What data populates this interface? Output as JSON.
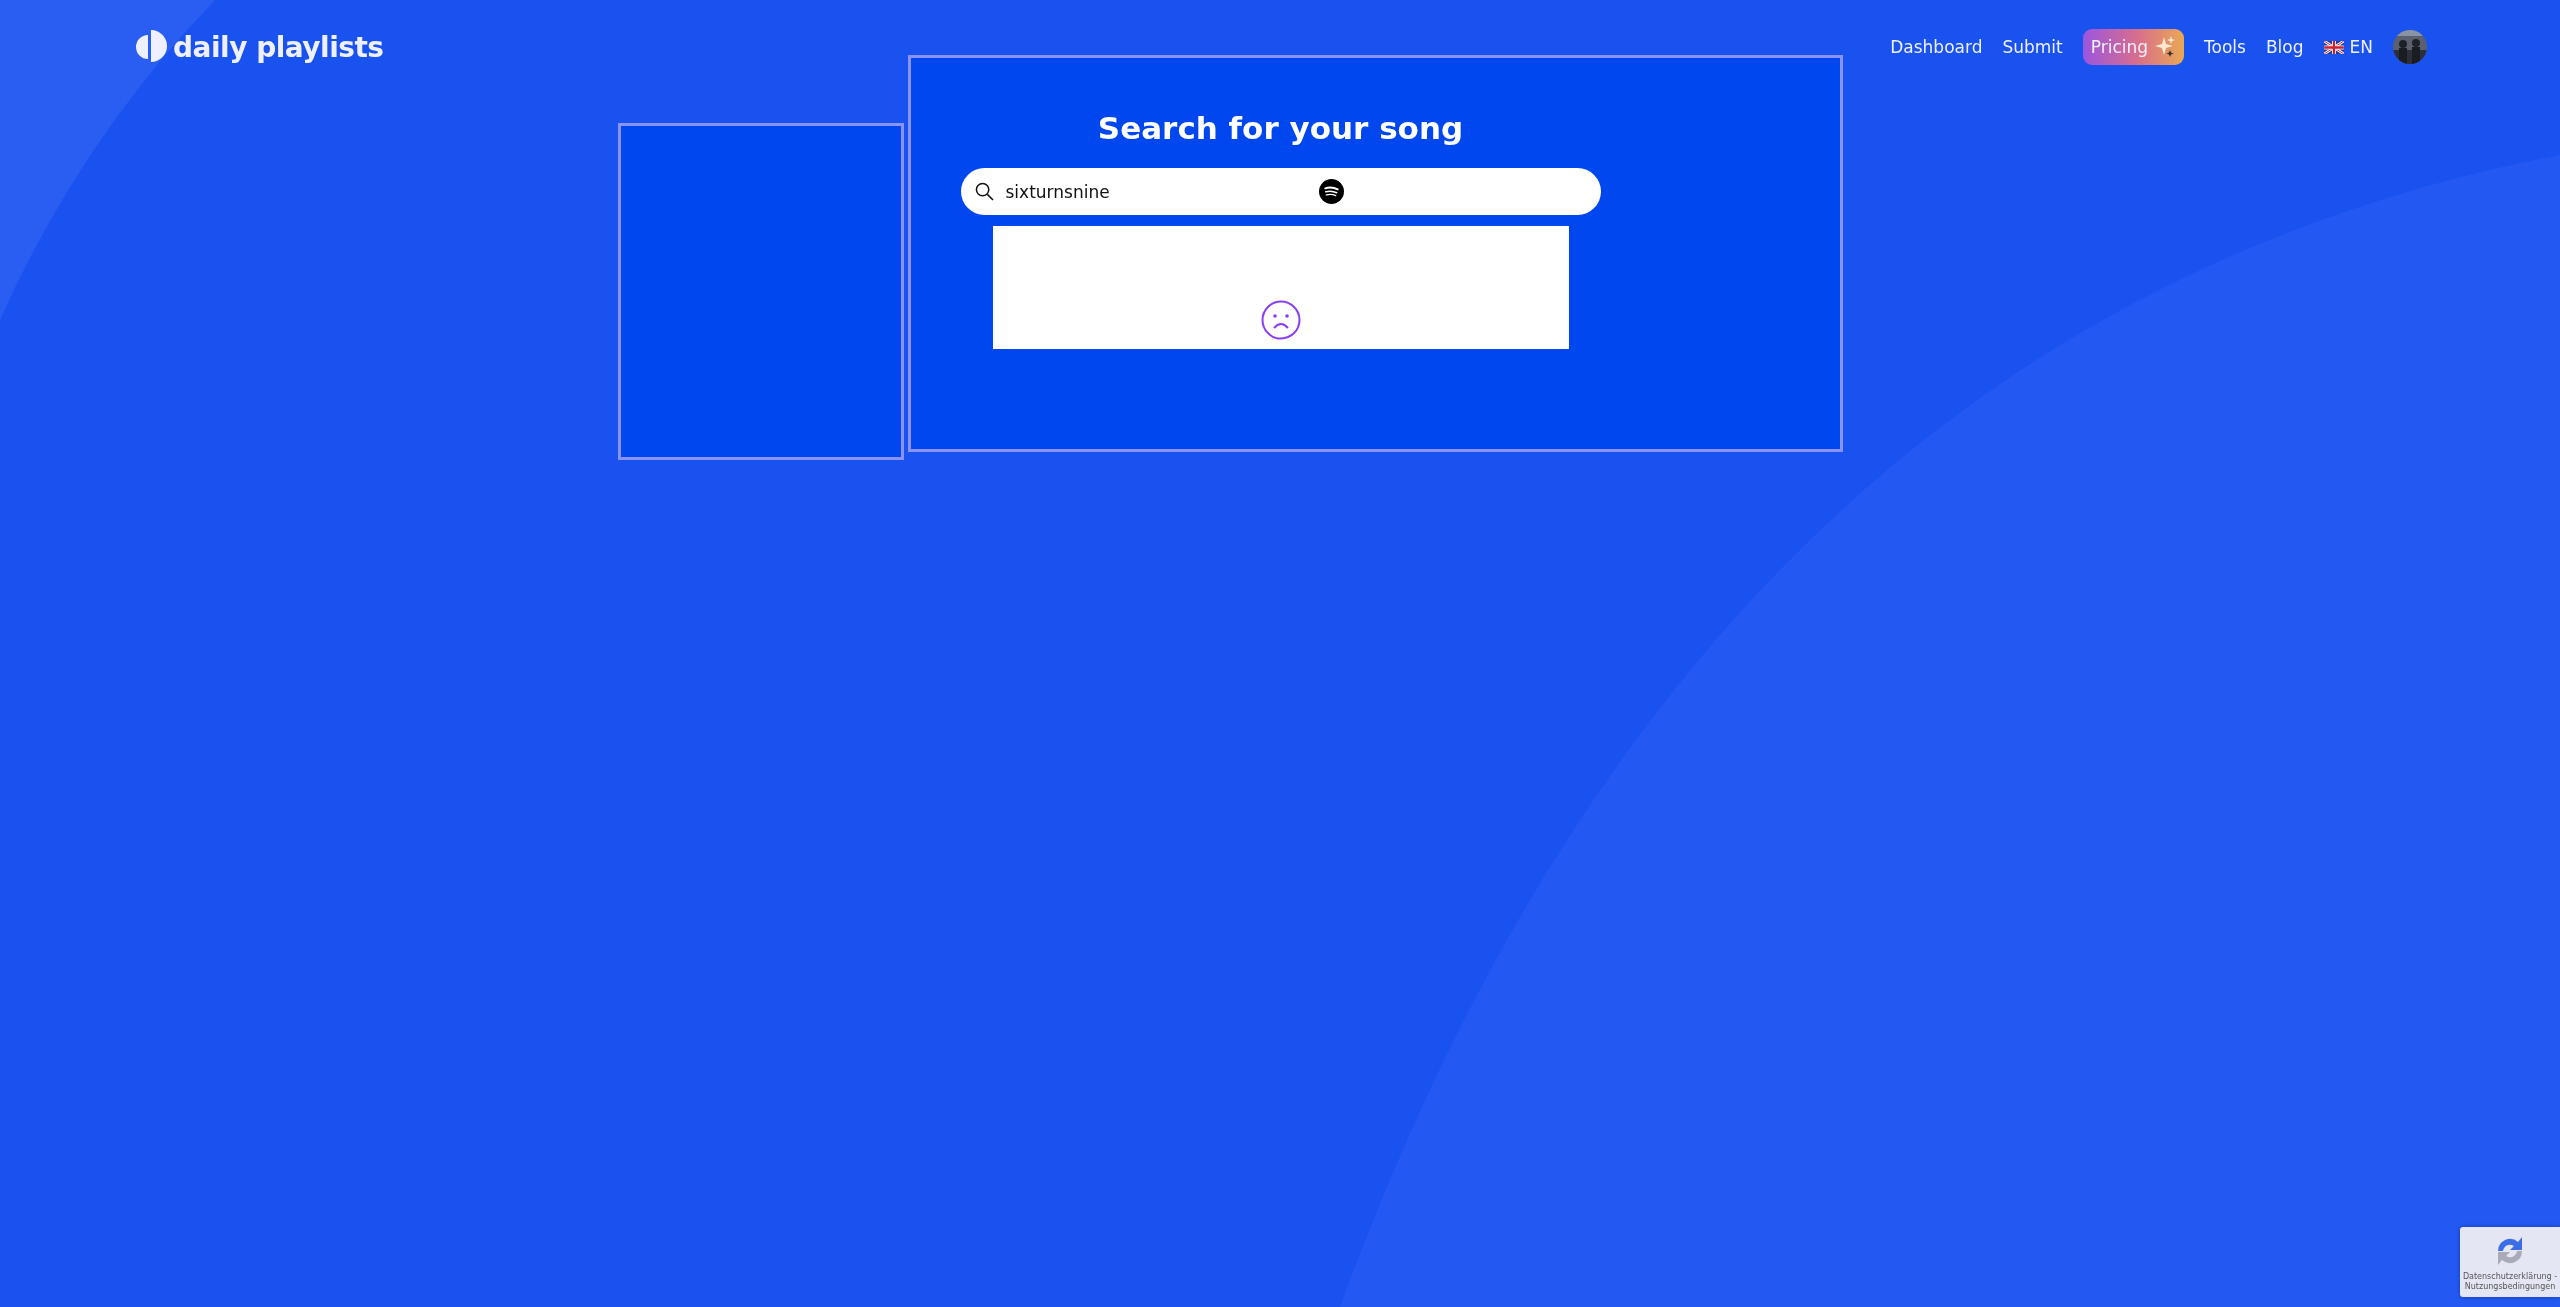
{
  "header": {
    "logo": "daily playlists",
    "nav": [
      {
        "label": "Dashboard",
        "kind": "link"
      },
      {
        "label": "Submit",
        "kind": "link"
      },
      {
        "label": "Pricing",
        "kind": "highlight"
      },
      {
        "label": "Tools",
        "kind": "link"
      },
      {
        "label": "Blog",
        "kind": "link"
      }
    ],
    "language": "EN"
  },
  "search": {
    "title": "Search for your song",
    "value": "sixturnsnine"
  },
  "results": {
    "empty": true
  },
  "recaptcha": {
    "text": "Datenschutzerklärung - Nutzungsbedingungen"
  }
}
